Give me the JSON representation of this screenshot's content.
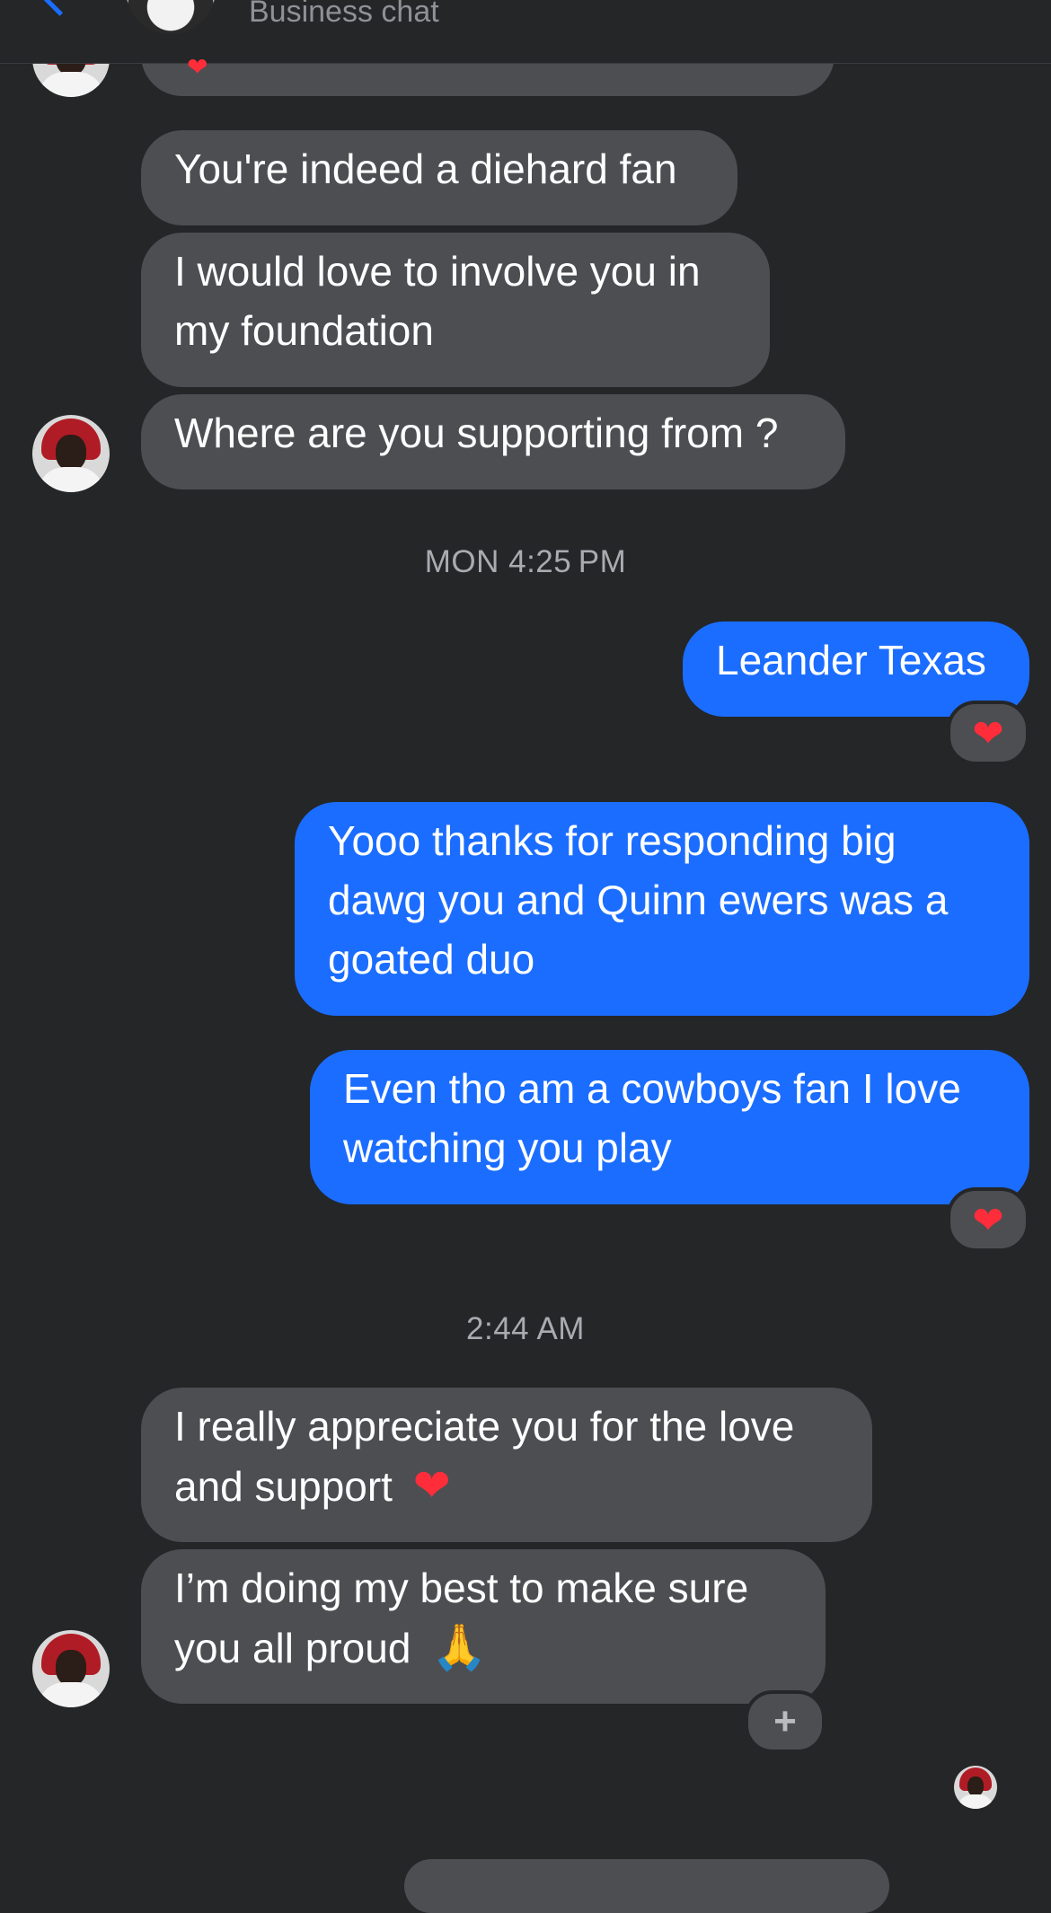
{
  "header": {
    "subtitle": "Business chat"
  },
  "messages": {
    "m1": "You're indeed a diehard fan",
    "m2_line1": "I would love to involve you in",
    "m2_line2": "my foundation",
    "m3": "Where are you supporting from ?",
    "ts1": "MON 4:25 PM",
    "m4": "Leander Texas",
    "m5_line1": "Yooo thanks for responding big",
    "m5_line2": "dawg  you  and Quinn ewers was a",
    "m5_line3": "goated duo",
    "m6_line1": "Even tho am a cowboys fan I love",
    "m6_line2": "watching you play",
    "ts2": "2:44 AM",
    "m7_line1": "I really appreciate you for the love",
    "m7_line2": "and support",
    "m8_line1": "I’m doing my best to make sure",
    "m8_line2": "you all proud"
  },
  "glyphs": {
    "heart": "❤",
    "pray": "🙏",
    "plus": "+"
  },
  "colors": {
    "outgoing": "#1b6dff",
    "incoming": "#4d4e52",
    "background": "#242628"
  },
  "icons": {
    "back": "chevron-left-icon",
    "reaction": "heart-icon",
    "add_reaction": "plus-icon"
  }
}
